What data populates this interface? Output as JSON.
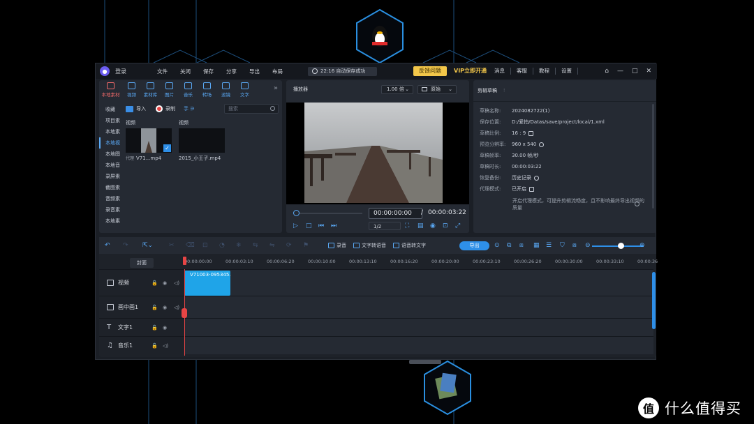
{
  "titlebar": {
    "login": "登录",
    "menu": [
      "文件",
      "关闭",
      "保存",
      "分享",
      "导出",
      "布局"
    ],
    "autosave": "22:16 自动保存成功",
    "feedback": "反馈问题",
    "vip": "VIP立即开通",
    "right": [
      "消息",
      "客服",
      "教程",
      "设置"
    ]
  },
  "media": {
    "tabs": [
      "本地素材",
      "视频",
      "素材库",
      "图片",
      "音乐",
      "转场",
      "滤镜",
      "文字"
    ],
    "sidebar": [
      "收藏",
      "项目素",
      "本地素",
      "本地视",
      "本地图",
      "本地音",
      "录屏素",
      "截图素",
      "音频素",
      "录音素",
      "本地素"
    ],
    "import_label": "导入",
    "record_label": "录制",
    "mini_label": "手 ∋",
    "search_placeholder": "搜索",
    "items": [
      {
        "caption": "视频",
        "badge": "代理",
        "name": "V71...mp4"
      },
      {
        "caption": "视频",
        "name": "2015_小王子.mp4"
      }
    ]
  },
  "player": {
    "title": "播放器",
    "speed": "1.00 倍",
    "quality": "原始",
    "current_time": "00:00:00:00",
    "separator": "/",
    "total_time": "00:00:03:22",
    "ratio": "1/2"
  },
  "props": {
    "title": "剪辑草稿",
    "rows": [
      {
        "k": "草稿名称:",
        "v": "2024082722(1)"
      },
      {
        "k": "保存位置:",
        "v": "D:/爱拍/Datas/save/project/local/1.xml"
      },
      {
        "k": "草稿比例:",
        "v": "16 : 9"
      },
      {
        "k": "预览分辨率:",
        "v": "960 x 540"
      },
      {
        "k": "草稿帧率:",
        "v": "30.00 帧/秒"
      },
      {
        "k": "草稿时长:",
        "v": "00:00:03:22"
      },
      {
        "k": "恢复备份:",
        "v": "历史记录"
      },
      {
        "k": "代理模式:",
        "v": "已开启"
      }
    ],
    "note": "开启代理模式，可提升剪辑流畅度，且不影响最终导出视频的质量"
  },
  "timeline": {
    "tools": {
      "record": "录音",
      "tts": "文字转语音",
      "stt": "语音转文字",
      "export": "导出"
    },
    "cover": "封面",
    "ticks": [
      "00:00:00:00",
      "00:00:03:10",
      "00:00:06:20",
      "00:00:10:00",
      "00:00:13:10",
      "00:00:16:20",
      "00:00:20:00",
      "00:00:23:10",
      "00:00:26:20",
      "00:00:30:00",
      "00:00:33:10",
      "00:00:36"
    ],
    "tracks": [
      "视频",
      "画中画1",
      "文字1",
      "音乐1"
    ],
    "clip_name": "V71003-095345.mp4"
  },
  "watermark": "什么值得买"
}
